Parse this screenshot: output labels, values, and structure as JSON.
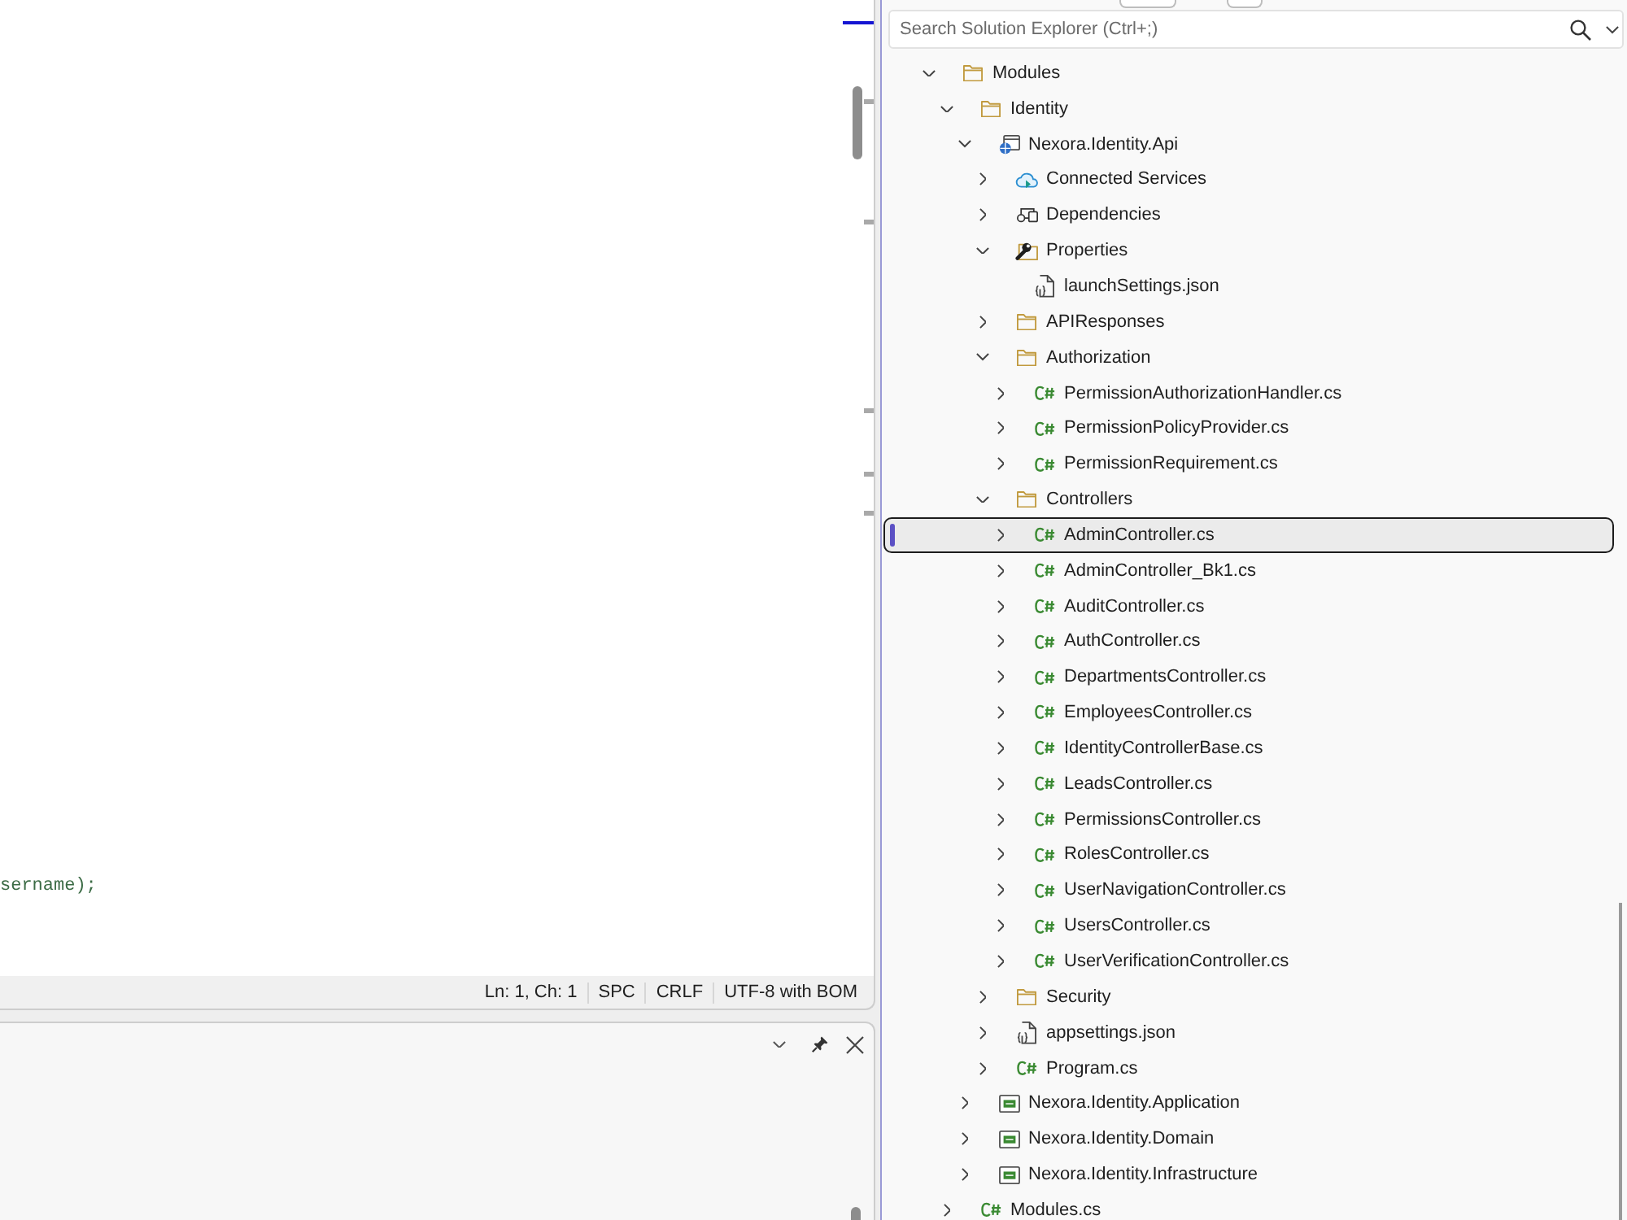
{
  "editor": {
    "code_line": "sername);"
  },
  "status_bar": {
    "items": [
      "Ln: 1, Ch: 1",
      "SPC",
      "CRLF",
      "UTF-8 with BOM"
    ]
  },
  "solution_explorer": {
    "search": {
      "placeholder": "Search Solution Explorer (Ctrl+;)"
    },
    "tree": [
      {
        "label": "Modules",
        "kind": "folder",
        "expanded": true,
        "selected": false,
        "children": [
          {
            "label": "Identity",
            "kind": "folder",
            "expanded": true,
            "selected": false,
            "children": [
              {
                "label": "Nexora.Identity.Api",
                "kind": "web-project",
                "expanded": true,
                "selected": false,
                "children": [
                  {
                    "label": "Connected Services",
                    "kind": "connected-services",
                    "expanded": false,
                    "selected": false
                  },
                  {
                    "label": "Dependencies",
                    "kind": "dependencies",
                    "expanded": false,
                    "selected": false
                  },
                  {
                    "label": "Properties",
                    "kind": "properties",
                    "expanded": true,
                    "selected": false,
                    "children": [
                      {
                        "label": "launchSettings.json",
                        "kind": "json",
                        "selected": false
                      }
                    ]
                  },
                  {
                    "label": "APIResponses",
                    "kind": "folder",
                    "expanded": false,
                    "selected": false
                  },
                  {
                    "label": "Authorization",
                    "kind": "folder",
                    "expanded": true,
                    "selected": false,
                    "children": [
                      {
                        "label": "PermissionAuthorizationHandler.cs",
                        "kind": "csharp",
                        "expanded": false,
                        "selected": false
                      },
                      {
                        "label": "PermissionPolicyProvider.cs",
                        "kind": "csharp",
                        "expanded": false,
                        "selected": false
                      },
                      {
                        "label": "PermissionRequirement.cs",
                        "kind": "csharp",
                        "expanded": false,
                        "selected": false
                      }
                    ]
                  },
                  {
                    "label": "Controllers",
                    "kind": "folder",
                    "expanded": true,
                    "selected": false,
                    "children": [
                      {
                        "label": "AdminController.cs",
                        "kind": "csharp",
                        "expanded": false,
                        "selected": true
                      },
                      {
                        "label": "AdminController_Bk1.cs",
                        "kind": "csharp",
                        "expanded": false,
                        "selected": false
                      },
                      {
                        "label": "AuditController.cs",
                        "kind": "csharp",
                        "expanded": false,
                        "selected": false
                      },
                      {
                        "label": "AuthController.cs",
                        "kind": "csharp",
                        "expanded": false,
                        "selected": false
                      },
                      {
                        "label": "DepartmentsController.cs",
                        "kind": "csharp",
                        "expanded": false,
                        "selected": false
                      },
                      {
                        "label": "EmployeesController.cs",
                        "kind": "csharp",
                        "expanded": false,
                        "selected": false
                      },
                      {
                        "label": "IdentityControllerBase.cs",
                        "kind": "csharp",
                        "expanded": false,
                        "selected": false
                      },
                      {
                        "label": "LeadsController.cs",
                        "kind": "csharp",
                        "expanded": false,
                        "selected": false
                      },
                      {
                        "label": "PermissionsController.cs",
                        "kind": "csharp",
                        "expanded": false,
                        "selected": false
                      },
                      {
                        "label": "RolesController.cs",
                        "kind": "csharp",
                        "expanded": false,
                        "selected": false
                      },
                      {
                        "label": "UserNavigationController.cs",
                        "kind": "csharp",
                        "expanded": false,
                        "selected": false
                      },
                      {
                        "label": "UsersController.cs",
                        "kind": "csharp",
                        "expanded": false,
                        "selected": false
                      },
                      {
                        "label": "UserVerificationController.cs",
                        "kind": "csharp",
                        "expanded": false,
                        "selected": false
                      }
                    ]
                  },
                  {
                    "label": "Security",
                    "kind": "folder",
                    "expanded": false,
                    "selected": false
                  },
                  {
                    "label": "appsettings.json",
                    "kind": "json",
                    "expanded": false,
                    "selected": false
                  },
                  {
                    "label": "Program.cs",
                    "kind": "csharp",
                    "expanded": false,
                    "selected": false
                  }
                ]
              },
              {
                "label": "Nexora.Identity.Application",
                "kind": "project",
                "expanded": false,
                "selected": false
              },
              {
                "label": "Nexora.Identity.Domain",
                "kind": "project",
                "expanded": false,
                "selected": false
              },
              {
                "label": "Nexora.Identity.Infrastructure",
                "kind": "project",
                "expanded": false,
                "selected": false
              }
            ]
          },
          {
            "label": "Modules.cs",
            "kind": "csharp",
            "expanded": false,
            "selected": false
          }
        ]
      }
    ]
  }
}
